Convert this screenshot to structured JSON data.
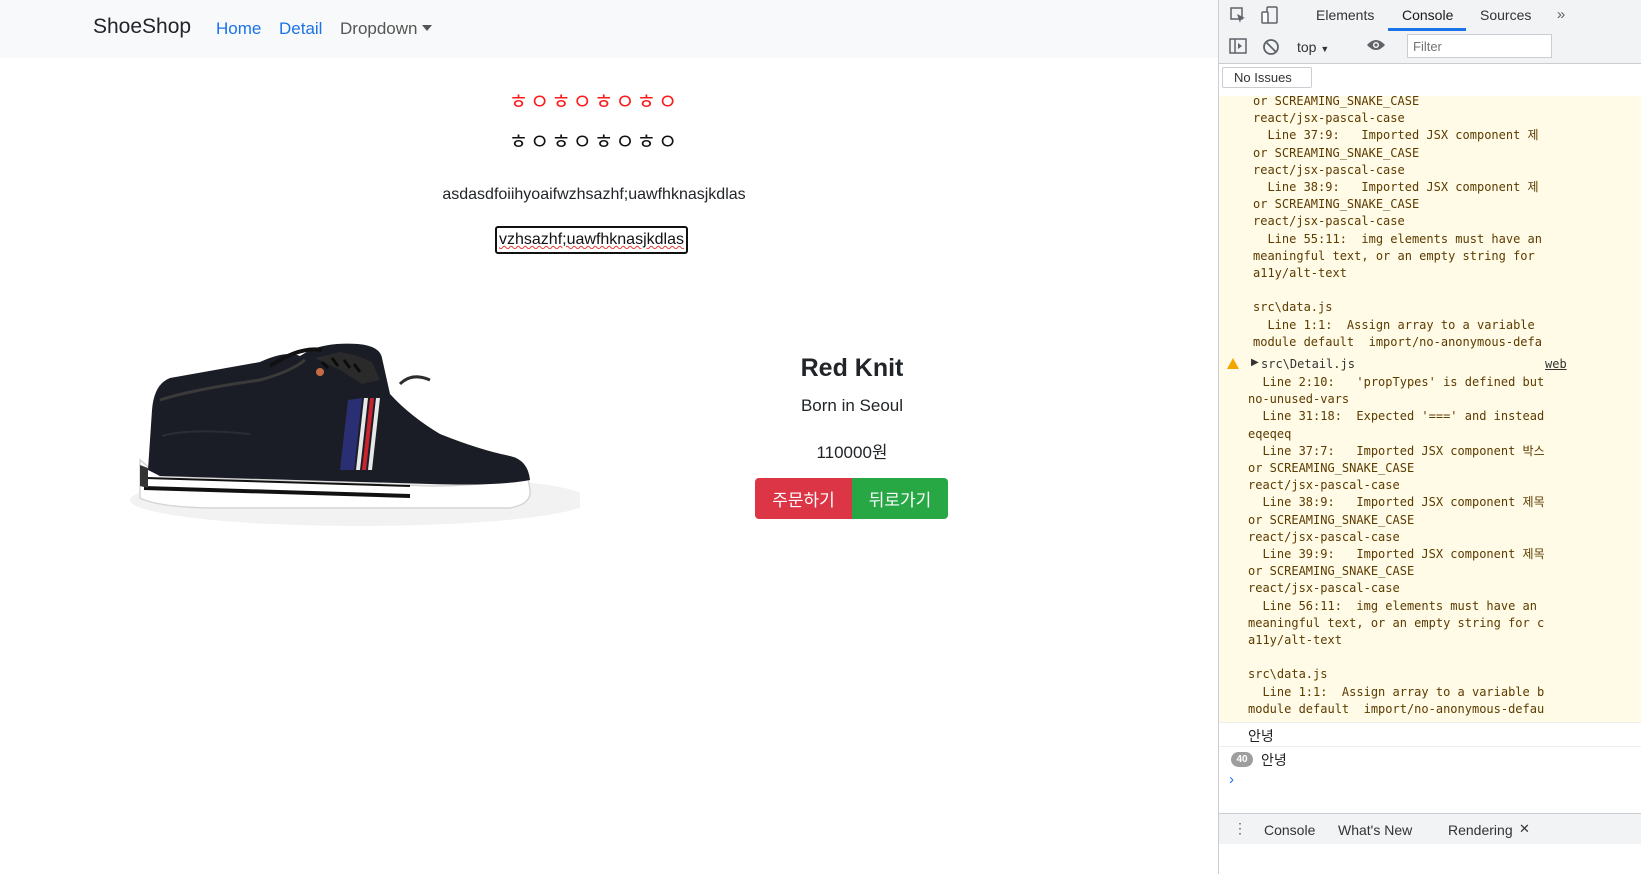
{
  "navbar": {
    "brand": "ShoeShop",
    "links": [
      "Home",
      "Detail",
      "Dropdown"
    ]
  },
  "content": {
    "hangul_red": "ㅎㅇㅎㅇㅎㅇㅎㅇ",
    "hangul_black": "ㅎㅇㅎㅇㅎㅇㅎㅇ",
    "text": "asdasdfoiihyoaifwzhsazhf;uawfhknasjkdlas",
    "input_value": "vzhsazhf;uawfhknasjkdlas"
  },
  "product": {
    "title": "Red Knit",
    "subtitle": "Born in Seoul",
    "price": "110000원",
    "order_button": "주문하기",
    "back_button": "뒤로가기"
  },
  "devtools": {
    "tabs": [
      "Elements",
      "Console",
      "Sources"
    ],
    "active_tab": "Console",
    "context": "top",
    "filter_placeholder": "Filter",
    "issues": "No Issues",
    "warning_block1": "or SCREAMING_SNAKE_CASE\nreact/jsx-pascal-case\n  Line 37:9:   Imported JSX component 제\nor SCREAMING_SNAKE_CASE\nreact/jsx-pascal-case\n  Line 38:9:   Imported JSX component 제\nor SCREAMING_SNAKE_CASE\nreact/jsx-pascal-case\n  Line 55:11:  img elements must have an\nmeaningful text, or an empty string for\na11y/alt-text\n\nsrc\\data.js\n  Line 1:1:  Assign array to a variable\nmodule default  import/no-anonymous-defa",
    "warning_source": "src\\Detail.js",
    "warning_link": "web",
    "warning_block2": "  Line 2:10:   'propTypes' is defined but\nno-unused-vars\n  Line 31:18:  Expected '===' and instead\neqeqeq\n  Line 37:7:   Imported JSX component 박스\nor SCREAMING_SNAKE_CASE\nreact/jsx-pascal-case\n  Line 38:9:   Imported JSX component 제목\nor SCREAMING_SNAKE_CASE\nreact/jsx-pascal-case\n  Line 39:9:   Imported JSX component 제목\nor SCREAMING_SNAKE_CASE\nreact/jsx-pascal-case\n  Line 56:11:  img elements must have an\nmeaningful text, or an empty string for c\na11y/alt-text\n\nsrc\\data.js\n  Line 1:1:  Assign array to a variable b\nmodule default  import/no-anonymous-defau",
    "log1": "안녕",
    "log2_count": "40",
    "log2": "안녕",
    "prompt": "›",
    "drawer_tabs": [
      "Console",
      "What's New",
      "Rendering"
    ],
    "accent_color": "#1a73e8",
    "warning_bg": "#fffbe6"
  }
}
